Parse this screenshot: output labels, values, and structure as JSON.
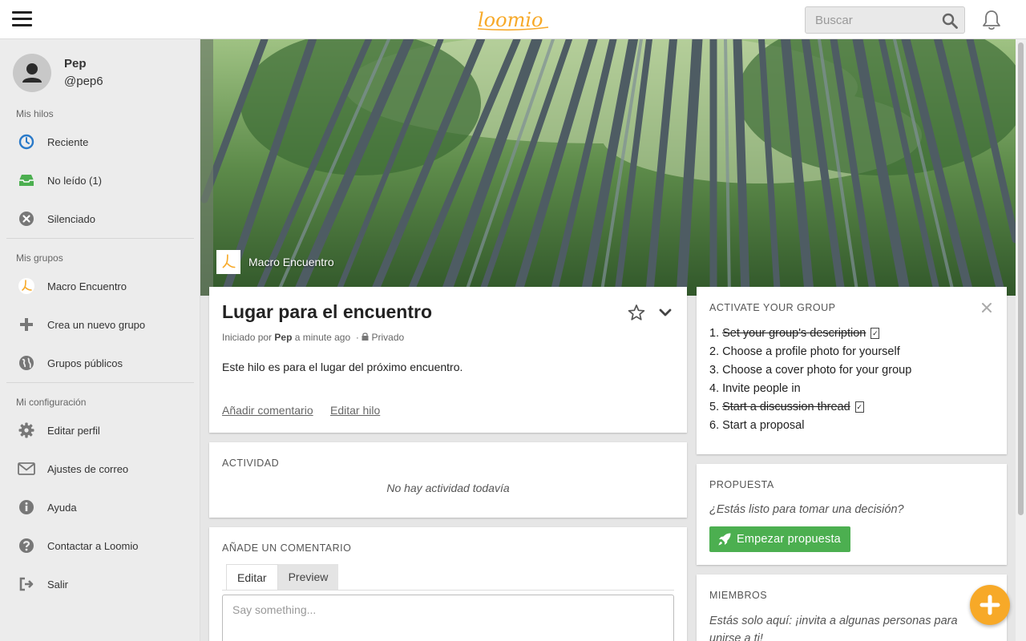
{
  "header": {
    "menu_icon": "hamburger-menu-icon",
    "logo_text": "loomio",
    "search_placeholder": "Buscar",
    "search_icon": "search-icon",
    "notifications_icon": "bell-icon"
  },
  "sidebar": {
    "user": {
      "name": "Pep",
      "handle": "@pep6"
    },
    "sections": {
      "threads": "Mis hilos",
      "groups": "Mis grupos",
      "settings": "Mi configuración"
    },
    "thread_items": [
      {
        "label": "Reciente",
        "icon": "clock-icon"
      },
      {
        "label": "No leído (1)",
        "icon": "inbox-icon"
      },
      {
        "label": "Silenciado",
        "icon": "mute-icon"
      }
    ],
    "group_items": [
      {
        "label": "Macro Encuentro",
        "icon": "group-logo-icon"
      },
      {
        "label": "Crea un nuevo grupo",
        "icon": "plus-icon"
      },
      {
        "label": "Grupos públicos",
        "icon": "globe-icon"
      }
    ],
    "settings_items": [
      {
        "label": "Editar perfil",
        "icon": "gear-icon"
      },
      {
        "label": "Ajustes de correo",
        "icon": "envelope-icon"
      },
      {
        "label": "Ayuda",
        "icon": "info-icon"
      },
      {
        "label": "Contactar a Loomio",
        "icon": "question-icon"
      },
      {
        "label": "Salir",
        "icon": "sign-out-icon"
      }
    ]
  },
  "cover": {
    "group_name": "Macro Encuentro"
  },
  "thread": {
    "title": "Lugar para el encuentro",
    "started_by_prefix": "Iniciado por",
    "author": "Pep",
    "time": "a minute ago",
    "separator": "·",
    "privacy": "Privado",
    "description": "Este hilo es para el lugar del próximo encuentro.",
    "add_comment_link": "Añadir comentario",
    "edit_thread_link": "Editar hilo"
  },
  "activity": {
    "heading": "Actividad",
    "empty": "No hay actividad todavía"
  },
  "comment": {
    "heading": "Añade un comentario",
    "tab_edit": "Editar",
    "tab_preview": "Preview",
    "placeholder": "Say something..."
  },
  "activate": {
    "heading": "Activate your group",
    "steps": [
      {
        "num": "1.",
        "text": "Set your group's description",
        "done": true
      },
      {
        "num": "2.",
        "text": "Choose a profile photo for yourself",
        "done": false
      },
      {
        "num": "3.",
        "text": "Choose a cover photo for your group",
        "done": false
      },
      {
        "num": "4.",
        "text": "Invite people in",
        "done": false
      },
      {
        "num": "5.",
        "text": "Start a discussion thread",
        "done": true
      },
      {
        "num": "6.",
        "text": "Start a proposal",
        "done": false
      }
    ]
  },
  "proposal": {
    "heading": "Propuesta",
    "question": "¿Estás listo para tomar una decisión?",
    "button_label": "Empezar propuesta"
  },
  "members": {
    "heading": "Miembros",
    "text": "Estás solo aquí: ¡invita a algunas personas para unirse a ti!"
  },
  "colors": {
    "brand_orange": "#f7a928",
    "success_green": "#4caf50",
    "clock_blue": "#2a7ac9"
  }
}
